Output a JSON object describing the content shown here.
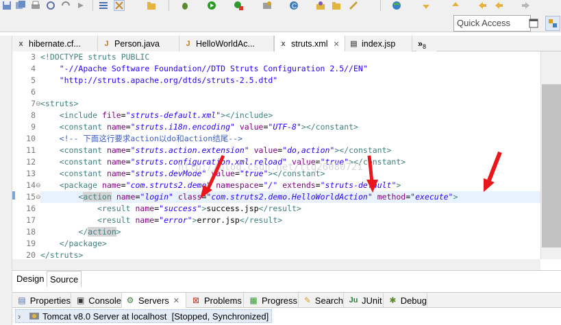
{
  "toolbar": {
    "icons": [
      "save-icon",
      "save-all-icon",
      "print-icon",
      "refresh-icon",
      "forward-refresh-icon",
      "step-icon",
      "outline-icon",
      "java-browse-icon",
      "debug-icon",
      "run-icon",
      "stop-run-icon",
      "external-tools-icon",
      "new-class-icon",
      "open-type-icon",
      "folder-icon",
      "task-icon",
      "globe-icon",
      "next-annotation-icon",
      "prev-annotation-icon",
      "back-icon",
      "forward-icon"
    ],
    "quick_access": "Quick Access"
  },
  "editor_tabs": [
    {
      "label": "hibernate.cf...",
      "icon": "xml-file-icon",
      "active": false
    },
    {
      "label": "Person.java",
      "icon": "java-file-icon",
      "active": false
    },
    {
      "label": "HelloWorldAc...",
      "icon": "java-file-icon",
      "active": false
    },
    {
      "label": "struts.xml",
      "icon": "xml-file-icon",
      "active": true,
      "close": "✕"
    },
    {
      "label": "index.jsp",
      "icon": "jsp-file-icon",
      "active": false
    }
  ],
  "overflow_tabs": {
    "symbol": "»",
    "count": "8"
  },
  "line_numbers": [
    "3",
    "4",
    "5",
    "6",
    "7",
    "8",
    "9",
    "10",
    "11",
    "12",
    "13",
    "14",
    "15",
    "16",
    "17",
    "18",
    "19",
    "20"
  ],
  "code": {
    "l3": "<!DOCTYPE struts PUBLIC",
    "l4": "\"-//Apache Software Foundation//DTD Struts Configuration 2.5//EN\"",
    "l5": "\"http://struts.apache.org/dtds/struts-2.5.dtd\"",
    "l7": "<struts>",
    "l8_tag": "<include",
    "l8_attr": "file",
    "l8_val": "\"struts-default.xml\"",
    "l8_end": "></include>",
    "l9_attr2": "value",
    "l9_val1": "\"struts.i18n.encoding\"",
    "l9_val2": "\"UTF-8\"",
    "l10": "<!-- 下面这行要求action以do和action结尾-->",
    "l11_val1": "\"struts.action.extension\"",
    "l11_val2": "\"do,action\"",
    "l12_val1": "\"struts.configuration.xml.reload\"",
    "l12_val2": "\"true\"",
    "l13_val1": "\"struts.devMode\"",
    "l13_val2": "\"true\"",
    "constant_tag": "<constant",
    "constant_end": "></constant>",
    "name_attr": "name",
    "l14_tag": "<package",
    "l14_val1": "\"com.struts2.demo\"",
    "l14_attr2": "namespace",
    "l14_val2": "\"/\"",
    "l14_attr3": "extends",
    "l14_val3": "\"struts-default\"",
    "l14_end": ">",
    "l15_lt": "<",
    "l15_tag": "action",
    "l15_val1": "\"login\"",
    "l15_attr2": "class",
    "l15_val2": "\"com.struts2.demo.HelloWorldAction\"",
    "l15_attr3": "method",
    "l15_val3": "\"execute\"",
    "l15_end": ">",
    "result_tag": "<result",
    "result_end": "</result>",
    "l16_val": "\"success\"",
    "l16_text": "success.jsp",
    "l17_val": "\"error\"",
    "l17_text": "error.jsp",
    "l18_lt": "</",
    "l18_tag": "action",
    "l18_end": ">",
    "l19": "</package>",
    "l20": "</struts>"
  },
  "watermark": "http://blog.csdn.net/ttq26080721",
  "design_source_tabs": {
    "design": "Design",
    "source": "Source",
    "active": "Source"
  },
  "bottom_tabs": [
    {
      "label": "Properties",
      "icon": "properties-icon"
    },
    {
      "label": "Console",
      "icon": "console-icon"
    },
    {
      "label": "Servers",
      "icon": "servers-icon",
      "active": true,
      "close": "✕"
    },
    {
      "label": "Problems",
      "icon": "problems-icon"
    },
    {
      "label": "Progress",
      "icon": "progress-icon"
    },
    {
      "label": "Search",
      "icon": "search-icon"
    },
    {
      "label": "JUnit",
      "icon": "junit-icon"
    },
    {
      "label": "Debug",
      "icon": "debug-icon"
    }
  ],
  "servers": {
    "row": "Tomcat v8.0 Server at localhost  [Stopped, Synchronized]",
    "expand": "›"
  },
  "colors": {
    "annotation_arrow": "#e8171b",
    "tag": "#3f7f7f",
    "attr": "#7f007f",
    "value": "#2a00ff",
    "comment": "#3f5fbf"
  }
}
